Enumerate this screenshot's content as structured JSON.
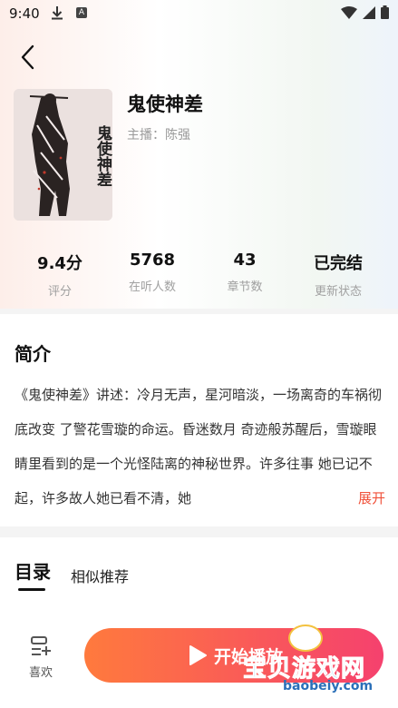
{
  "status": {
    "time": "9:40"
  },
  "book": {
    "title": "鬼使神差",
    "anchor": "主播：陈强",
    "cover_text": "鬼使神差"
  },
  "stats": [
    {
      "value": "9.4分",
      "label": "评分"
    },
    {
      "value": "5768",
      "label": "在听人数"
    },
    {
      "value": "43",
      "label": "章节数"
    },
    {
      "value": "已完结",
      "label": "更新状态"
    }
  ],
  "intro": {
    "heading": "简介",
    "text": "《鬼使神差》讲述：冷月无声，星河暗淡，一场离奇的车祸彻底改变 了警花雪璇的命运。昏迷数月 奇迹般苏醒后，雪璇眼睛里看到的是一个光怪陆离的神秘世界。许多往事 她已记不 起，许多故人她已看不清，她",
    "more": "展开"
  },
  "tabs": {
    "catalog": "目录",
    "similar": "相似推荐"
  },
  "bottom": {
    "fav_label": "喜欢",
    "play_label": "开始播放"
  },
  "watermark": {
    "title": "宝贝游戏网",
    "url": "baobeiy.com"
  },
  "colors": {
    "accent": "#f0513a",
    "play_start": "#ff7a3d",
    "play_end": "#f5416e"
  }
}
